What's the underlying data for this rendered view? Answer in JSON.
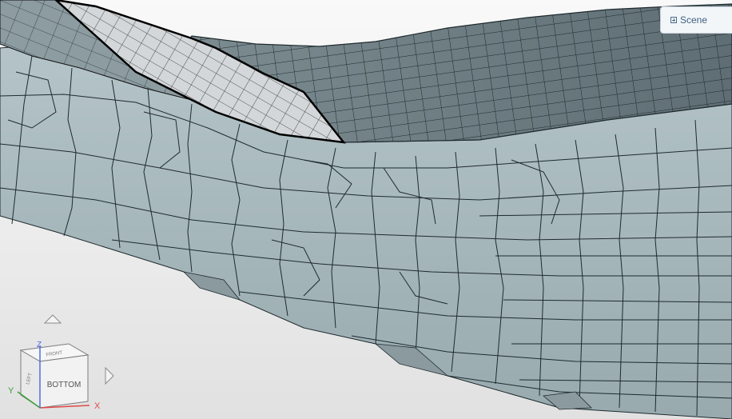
{
  "scene_panel": {
    "label": "Scene",
    "icon": "plus-box-icon"
  },
  "viewcube": {
    "face_front": "BOTTOM",
    "face_top": "FRONT",
    "face_left": "LEFT",
    "axis_x": "X",
    "axis_y": "Y",
    "axis_z": "Z"
  },
  "navigation": {
    "up_icon": "triangle-up-icon",
    "right_icon": "triangle-right-icon"
  },
  "colors": {
    "mesh_face": "#a9bbc0",
    "mesh_face_dark": "#85999e",
    "top_surface": "#6f7f85",
    "selected_surface": "#d4d8da",
    "edge": "#1e2a2e",
    "axis_x": "#e04848",
    "axis_y": "#3ca03c",
    "axis_z": "#4c6ee0"
  }
}
